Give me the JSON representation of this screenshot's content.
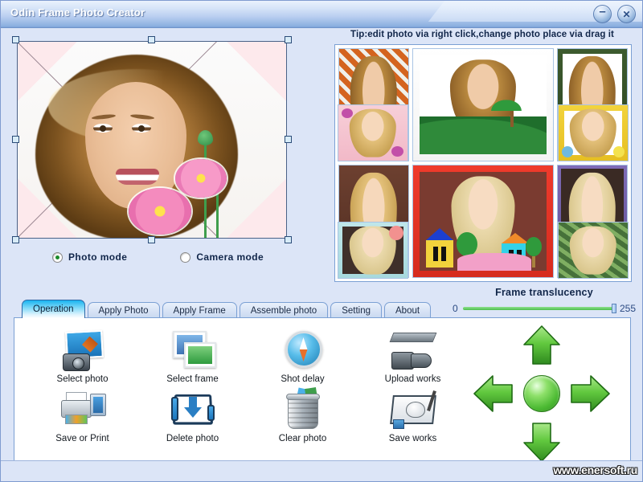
{
  "window": {
    "title": "Odin Frame Photo Creator",
    "minimize_label": "–",
    "close_label": "✕"
  },
  "tip": {
    "text": "Tip:edit photo via right click,change photo place via drag it"
  },
  "modes": {
    "photo": {
      "label": "Photo mode",
      "selected": true
    },
    "camera": {
      "label": "Camera mode",
      "selected": false
    }
  },
  "translucency": {
    "title": "Frame translucency",
    "min": "0",
    "max": "255",
    "value": "255"
  },
  "tabs": [
    {
      "label": "Operation",
      "active": true
    },
    {
      "label": "Apply Photo",
      "active": false
    },
    {
      "label": "Apply Frame",
      "active": false
    },
    {
      "label": "Assemble photo",
      "active": false
    },
    {
      "label": "Setting",
      "active": false
    },
    {
      "label": "About",
      "active": false
    }
  ],
  "actions": [
    {
      "label": "Select photo",
      "icon": "photo-stack-camera-icon"
    },
    {
      "label": "Select frame",
      "icon": "picture-frames-icon"
    },
    {
      "label": "Shot delay",
      "icon": "compass-timer-icon"
    },
    {
      "label": "Upload works",
      "icon": "camera-upload-icon"
    },
    {
      "label": "Save or Print",
      "icon": "printer-monitor-icon"
    },
    {
      "label": "Delete photo",
      "icon": "blue-down-arrow-box-icon"
    },
    {
      "label": "Clear photo",
      "icon": "trash-can-icon"
    },
    {
      "label": "Save works",
      "icon": "drawing-board-mouse-icon"
    }
  ],
  "dpad": {
    "up": "move-up-arrow",
    "down": "move-down-arrow",
    "left": "move-left-arrow",
    "right": "move-right-arrow",
    "center": "reset-center-button"
  },
  "thumbnails": {
    "left_column": [
      {
        "name": "orange-mosaic-frame-brunette",
        "frame": "fr-orange",
        "hair": "brunette"
      },
      {
        "name": "pink-floral-frame-blonde",
        "frame": "fr-pinkfl",
        "hair": "blonde"
      },
      {
        "name": "snowman-winter-frame-blonde",
        "frame": "fr-snow",
        "hair": "blonde"
      },
      {
        "name": "pastel-sun-frame-platinum",
        "frame": "fr-pastel",
        "hair": "platinum"
      }
    ],
    "right_column": [
      {
        "name": "green-torn-frame-brunette",
        "frame": "fr-green",
        "hair": "brunette"
      },
      {
        "name": "yellow-flower-frame-blonde",
        "frame": "fr-yellow",
        "hair": "blonde"
      },
      {
        "name": "blue-red-sketch-frame-platinum",
        "frame": "fr-blue",
        "hair": "platinum"
      },
      {
        "name": "ivy-leaf-frame-platinum",
        "frame": "fr-ivy",
        "hair": "platinum"
      }
    ],
    "center": [
      {
        "name": "island-palm-scene-brunette",
        "frame": "fr-white",
        "hair": "brunette"
      },
      {
        "name": "red-border-houses-platinum",
        "frame": "fr-red",
        "hair": "platinum"
      }
    ]
  },
  "canvas": {
    "name": "main-photo-canvas",
    "frame_color": "#fde9ec",
    "selected": true,
    "handle_count": 8
  },
  "statusbar": {
    "watermark": "www.enersoft.ru"
  },
  "colors": {
    "window_bg": "#dce5f7",
    "titlebar_accent": "#7aa2d8",
    "panel_border": "#7ba0d4",
    "active_tab": "#1ab4f0",
    "slider_track": "#4cbf4c",
    "arrow_green": "#4cba33",
    "text_dark": "#11264a"
  }
}
